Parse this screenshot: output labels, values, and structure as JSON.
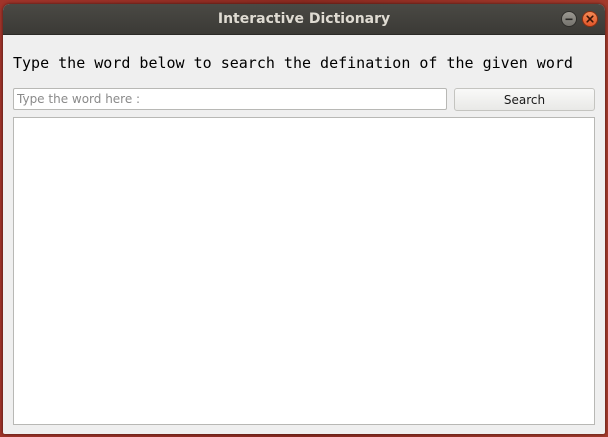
{
  "window": {
    "title": "Interactive Dictionary",
    "controls": {
      "minimize_icon": "minimize-icon",
      "close_icon": "close-icon"
    }
  },
  "main": {
    "prompt": "Type the word below to search the defination of the given word",
    "search": {
      "placeholder": "Type the word here :",
      "value": ""
    },
    "search_button_label": "Search",
    "results_text": ""
  },
  "colors": {
    "titlebar": "#3b3a36",
    "close_button": "#e0562a",
    "window_background": "#efefef"
  }
}
